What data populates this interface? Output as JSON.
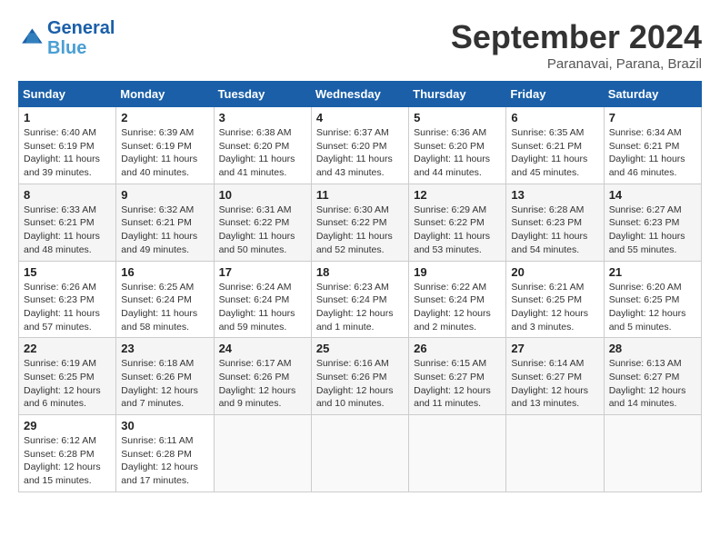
{
  "header": {
    "logo_line1": "General",
    "logo_line2": "Blue",
    "month": "September 2024",
    "location": "Paranavai, Parana, Brazil"
  },
  "weekdays": [
    "Sunday",
    "Monday",
    "Tuesday",
    "Wednesday",
    "Thursday",
    "Friday",
    "Saturday"
  ],
  "weeks": [
    [
      {
        "day": "1",
        "sunrise": "6:40 AM",
        "sunset": "6:19 PM",
        "daylight": "11 hours and 39 minutes."
      },
      {
        "day": "2",
        "sunrise": "6:39 AM",
        "sunset": "6:19 PM",
        "daylight": "11 hours and 40 minutes."
      },
      {
        "day": "3",
        "sunrise": "6:38 AM",
        "sunset": "6:20 PM",
        "daylight": "11 hours and 41 minutes."
      },
      {
        "day": "4",
        "sunrise": "6:37 AM",
        "sunset": "6:20 PM",
        "daylight": "11 hours and 43 minutes."
      },
      {
        "day": "5",
        "sunrise": "6:36 AM",
        "sunset": "6:20 PM",
        "daylight": "11 hours and 44 minutes."
      },
      {
        "day": "6",
        "sunrise": "6:35 AM",
        "sunset": "6:21 PM",
        "daylight": "11 hours and 45 minutes."
      },
      {
        "day": "7",
        "sunrise": "6:34 AM",
        "sunset": "6:21 PM",
        "daylight": "11 hours and 46 minutes."
      }
    ],
    [
      {
        "day": "8",
        "sunrise": "6:33 AM",
        "sunset": "6:21 PM",
        "daylight": "11 hours and 48 minutes."
      },
      {
        "day": "9",
        "sunrise": "6:32 AM",
        "sunset": "6:21 PM",
        "daylight": "11 hours and 49 minutes."
      },
      {
        "day": "10",
        "sunrise": "6:31 AM",
        "sunset": "6:22 PM",
        "daylight": "11 hours and 50 minutes."
      },
      {
        "day": "11",
        "sunrise": "6:30 AM",
        "sunset": "6:22 PM",
        "daylight": "11 hours and 52 minutes."
      },
      {
        "day": "12",
        "sunrise": "6:29 AM",
        "sunset": "6:22 PM",
        "daylight": "11 hours and 53 minutes."
      },
      {
        "day": "13",
        "sunrise": "6:28 AM",
        "sunset": "6:23 PM",
        "daylight": "11 hours and 54 minutes."
      },
      {
        "day": "14",
        "sunrise": "6:27 AM",
        "sunset": "6:23 PM",
        "daylight": "11 hours and 55 minutes."
      }
    ],
    [
      {
        "day": "15",
        "sunrise": "6:26 AM",
        "sunset": "6:23 PM",
        "daylight": "11 hours and 57 minutes."
      },
      {
        "day": "16",
        "sunrise": "6:25 AM",
        "sunset": "6:24 PM",
        "daylight": "11 hours and 58 minutes."
      },
      {
        "day": "17",
        "sunrise": "6:24 AM",
        "sunset": "6:24 PM",
        "daylight": "11 hours and 59 minutes."
      },
      {
        "day": "18",
        "sunrise": "6:23 AM",
        "sunset": "6:24 PM",
        "daylight": "12 hours and 1 minute."
      },
      {
        "day": "19",
        "sunrise": "6:22 AM",
        "sunset": "6:24 PM",
        "daylight": "12 hours and 2 minutes."
      },
      {
        "day": "20",
        "sunrise": "6:21 AM",
        "sunset": "6:25 PM",
        "daylight": "12 hours and 3 minutes."
      },
      {
        "day": "21",
        "sunrise": "6:20 AM",
        "sunset": "6:25 PM",
        "daylight": "12 hours and 5 minutes."
      }
    ],
    [
      {
        "day": "22",
        "sunrise": "6:19 AM",
        "sunset": "6:25 PM",
        "daylight": "12 hours and 6 minutes."
      },
      {
        "day": "23",
        "sunrise": "6:18 AM",
        "sunset": "6:26 PM",
        "daylight": "12 hours and 7 minutes."
      },
      {
        "day": "24",
        "sunrise": "6:17 AM",
        "sunset": "6:26 PM",
        "daylight": "12 hours and 9 minutes."
      },
      {
        "day": "25",
        "sunrise": "6:16 AM",
        "sunset": "6:26 PM",
        "daylight": "12 hours and 10 minutes."
      },
      {
        "day": "26",
        "sunrise": "6:15 AM",
        "sunset": "6:27 PM",
        "daylight": "12 hours and 11 minutes."
      },
      {
        "day": "27",
        "sunrise": "6:14 AM",
        "sunset": "6:27 PM",
        "daylight": "12 hours and 13 minutes."
      },
      {
        "day": "28",
        "sunrise": "6:13 AM",
        "sunset": "6:27 PM",
        "daylight": "12 hours and 14 minutes."
      }
    ],
    [
      {
        "day": "29",
        "sunrise": "6:12 AM",
        "sunset": "6:28 PM",
        "daylight": "12 hours and 15 minutes."
      },
      {
        "day": "30",
        "sunrise": "6:11 AM",
        "sunset": "6:28 PM",
        "daylight": "12 hours and 17 minutes."
      },
      null,
      null,
      null,
      null,
      null
    ]
  ]
}
